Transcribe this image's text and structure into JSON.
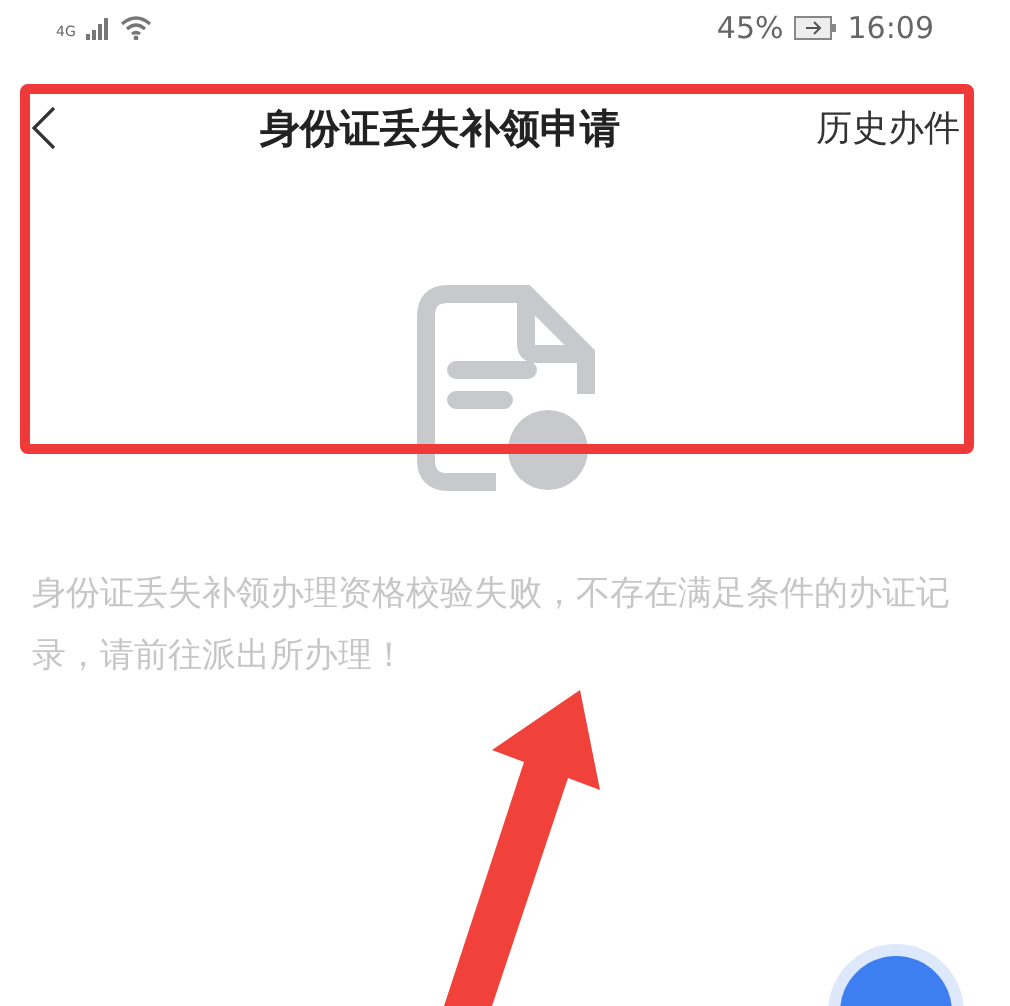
{
  "status_bar": {
    "network": "4G",
    "battery": "45%",
    "time": "16:09"
  },
  "header": {
    "title": "身份证丢失补领申请",
    "action": "历史办件"
  },
  "message": "身份证丢失补领办理资格校验失败，不存在满足条件的办证记录，请前往派出所办理！"
}
